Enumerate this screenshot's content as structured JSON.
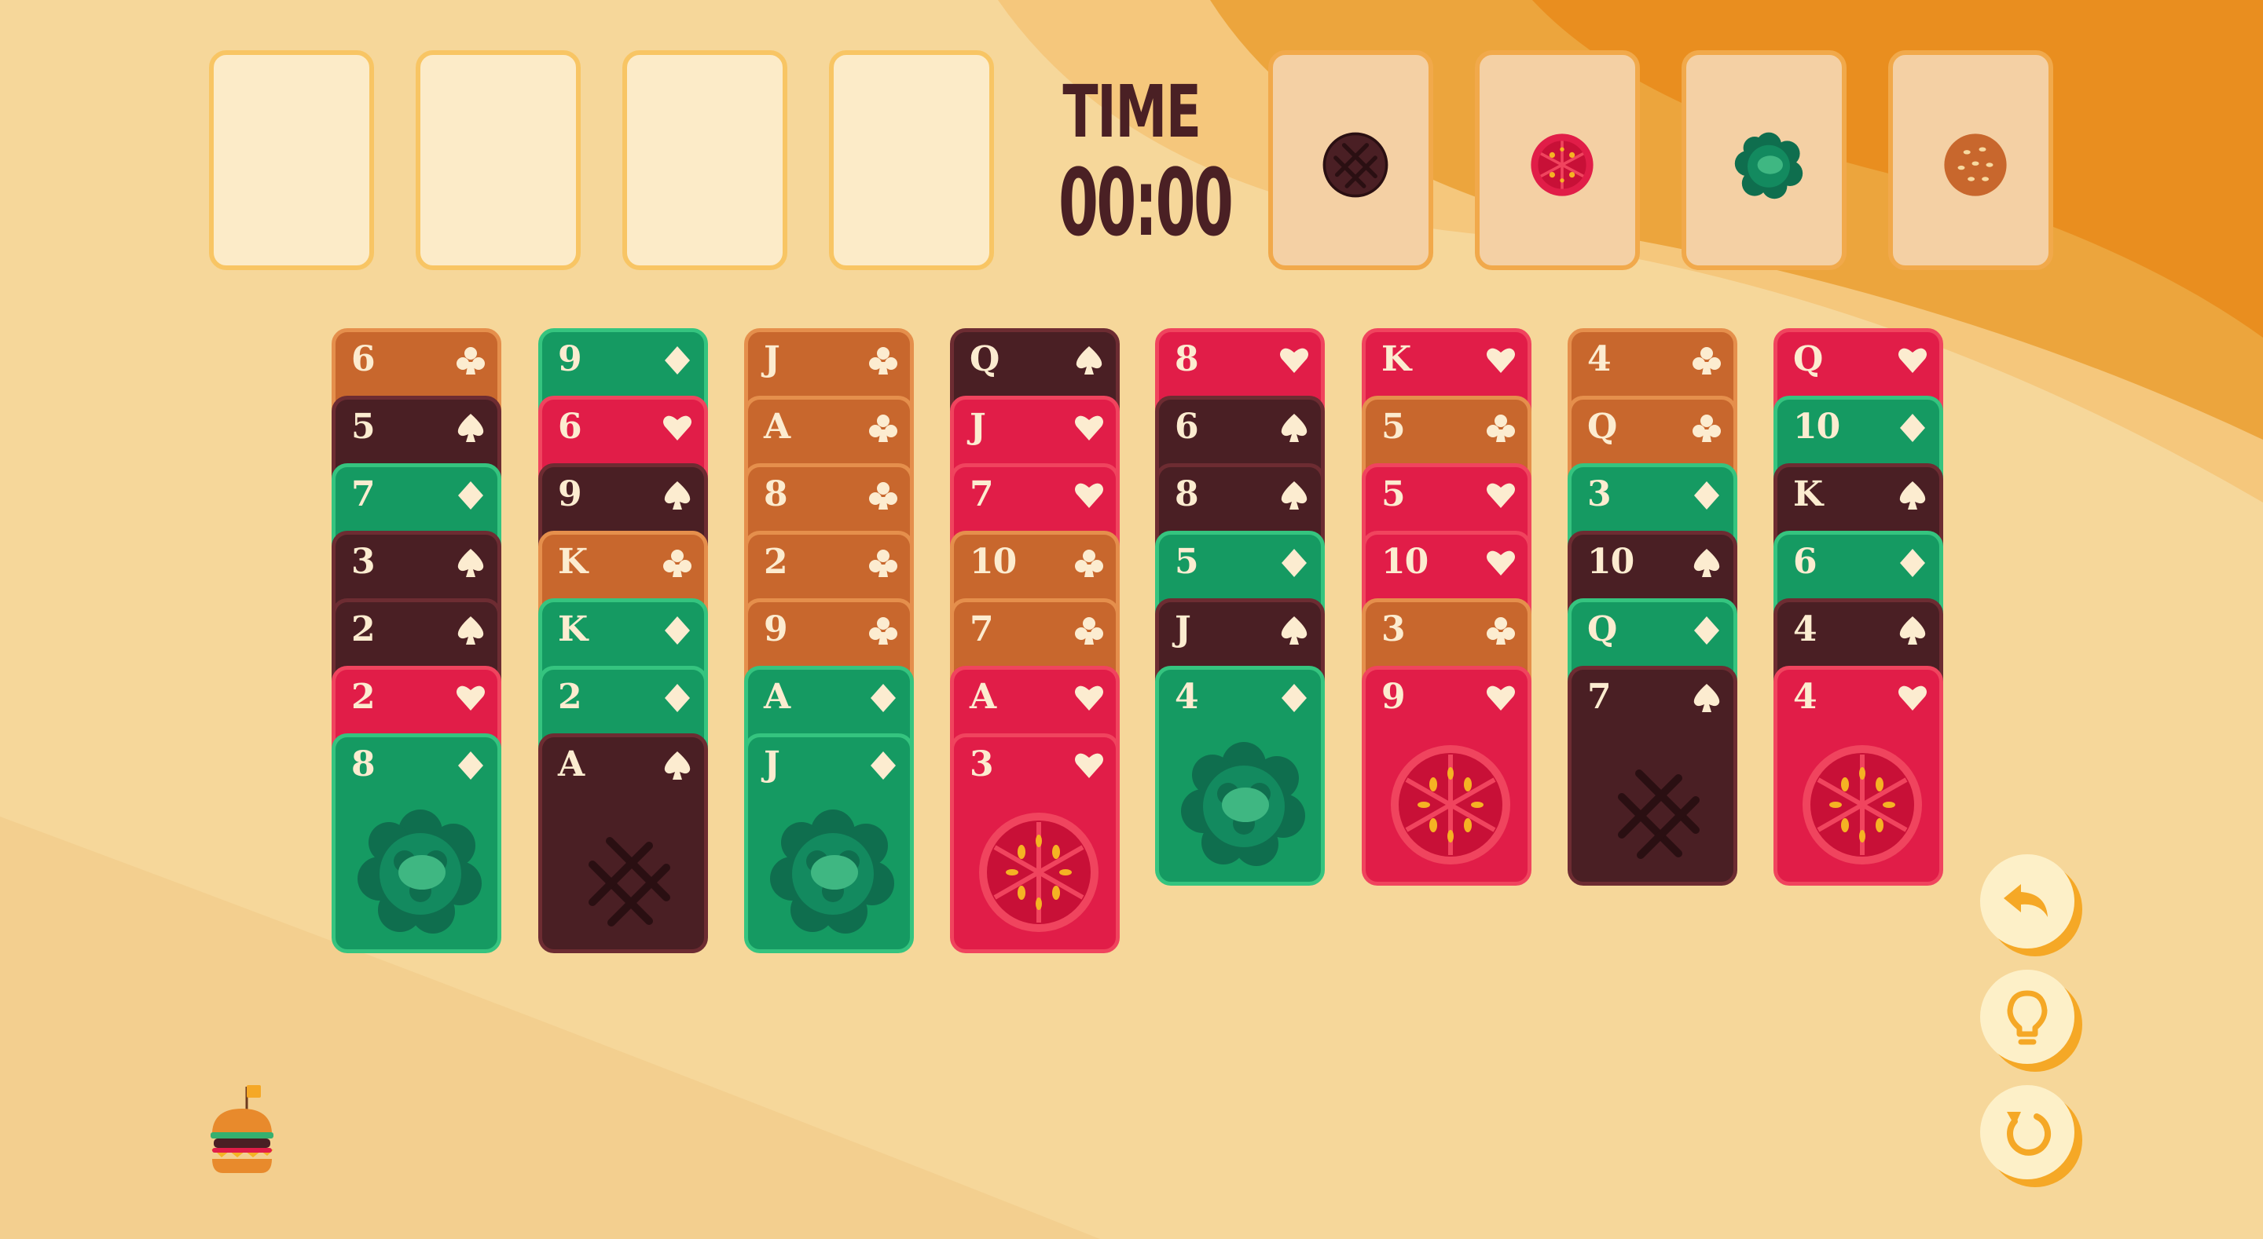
{
  "timer": {
    "label": "TIME",
    "value": "00:00"
  },
  "free_cells": [
    {
      "name": "free-cell-1"
    },
    {
      "name": "free-cell-2"
    },
    {
      "name": "free-cell-3"
    },
    {
      "name": "free-cell-4"
    }
  ],
  "foundations": [
    {
      "suit": "spades",
      "icon": "grill-patty-icon"
    },
    {
      "suit": "hearts",
      "icon": "tomato-icon"
    },
    {
      "suit": "diamonds",
      "icon": "lettuce-icon"
    },
    {
      "suit": "clubs",
      "icon": "bun-icon"
    }
  ],
  "suit_colors": {
    "spades": "#4a1f24",
    "hearts": "#e11d48",
    "diamonds": "#159a62",
    "clubs": "#c8672d"
  },
  "suit_borders": {
    "spades": "#6d2c32",
    "hearts": "#f0445e",
    "diamonds": "#35c47f",
    "clubs": "#e58f4c"
  },
  "tableau": [
    [
      {
        "rank": "6",
        "suit": "clubs"
      },
      {
        "rank": "5",
        "suit": "spades"
      },
      {
        "rank": "7",
        "suit": "diamonds"
      },
      {
        "rank": "3",
        "suit": "spades"
      },
      {
        "rank": "2",
        "suit": "spades"
      },
      {
        "rank": "2",
        "suit": "hearts"
      },
      {
        "rank": "8",
        "suit": "diamonds"
      }
    ],
    [
      {
        "rank": "9",
        "suit": "diamonds"
      },
      {
        "rank": "6",
        "suit": "hearts"
      },
      {
        "rank": "9",
        "suit": "spades"
      },
      {
        "rank": "K",
        "suit": "clubs"
      },
      {
        "rank": "K",
        "suit": "diamonds"
      },
      {
        "rank": "2",
        "suit": "diamonds"
      },
      {
        "rank": "A",
        "suit": "spades"
      }
    ],
    [
      {
        "rank": "J",
        "suit": "clubs"
      },
      {
        "rank": "A",
        "suit": "clubs"
      },
      {
        "rank": "8",
        "suit": "clubs"
      },
      {
        "rank": "2",
        "suit": "clubs"
      },
      {
        "rank": "9",
        "suit": "clubs"
      },
      {
        "rank": "A",
        "suit": "diamonds"
      },
      {
        "rank": "J",
        "suit": "diamonds"
      }
    ],
    [
      {
        "rank": "Q",
        "suit": "spades"
      },
      {
        "rank": "J",
        "suit": "hearts"
      },
      {
        "rank": "7",
        "suit": "hearts"
      },
      {
        "rank": "10",
        "suit": "clubs"
      },
      {
        "rank": "7",
        "suit": "clubs"
      },
      {
        "rank": "A",
        "suit": "hearts"
      },
      {
        "rank": "3",
        "suit": "hearts"
      }
    ],
    [
      {
        "rank": "8",
        "suit": "hearts"
      },
      {
        "rank": "6",
        "suit": "spades"
      },
      {
        "rank": "8",
        "suit": "spades"
      },
      {
        "rank": "5",
        "suit": "diamonds"
      },
      {
        "rank": "J",
        "suit": "spades"
      },
      {
        "rank": "4",
        "suit": "diamonds"
      }
    ],
    [
      {
        "rank": "K",
        "suit": "hearts"
      },
      {
        "rank": "5",
        "suit": "clubs"
      },
      {
        "rank": "5",
        "suit": "hearts"
      },
      {
        "rank": "10",
        "suit": "hearts"
      },
      {
        "rank": "3",
        "suit": "clubs"
      },
      {
        "rank": "9",
        "suit": "hearts"
      }
    ],
    [
      {
        "rank": "4",
        "suit": "clubs"
      },
      {
        "rank": "Q",
        "suit": "clubs"
      },
      {
        "rank": "3",
        "suit": "diamonds"
      },
      {
        "rank": "10",
        "suit": "spades"
      },
      {
        "rank": "Q",
        "suit": "diamonds"
      },
      {
        "rank": "7",
        "suit": "spades"
      }
    ],
    [
      {
        "rank": "Q",
        "suit": "hearts"
      },
      {
        "rank": "10",
        "suit": "diamonds"
      },
      {
        "rank": "K",
        "suit": "spades"
      },
      {
        "rank": "6",
        "suit": "diamonds"
      },
      {
        "rank": "4",
        "suit": "spades"
      },
      {
        "rank": "4",
        "suit": "hearts"
      }
    ]
  ],
  "controls": [
    {
      "name": "undo-button",
      "icon": "undo-arrow-icon"
    },
    {
      "name": "hint-button",
      "icon": "lightbulb-icon"
    },
    {
      "name": "restart-button",
      "icon": "restart-icon"
    }
  ],
  "logo": {
    "icon": "burger-logo-icon"
  }
}
